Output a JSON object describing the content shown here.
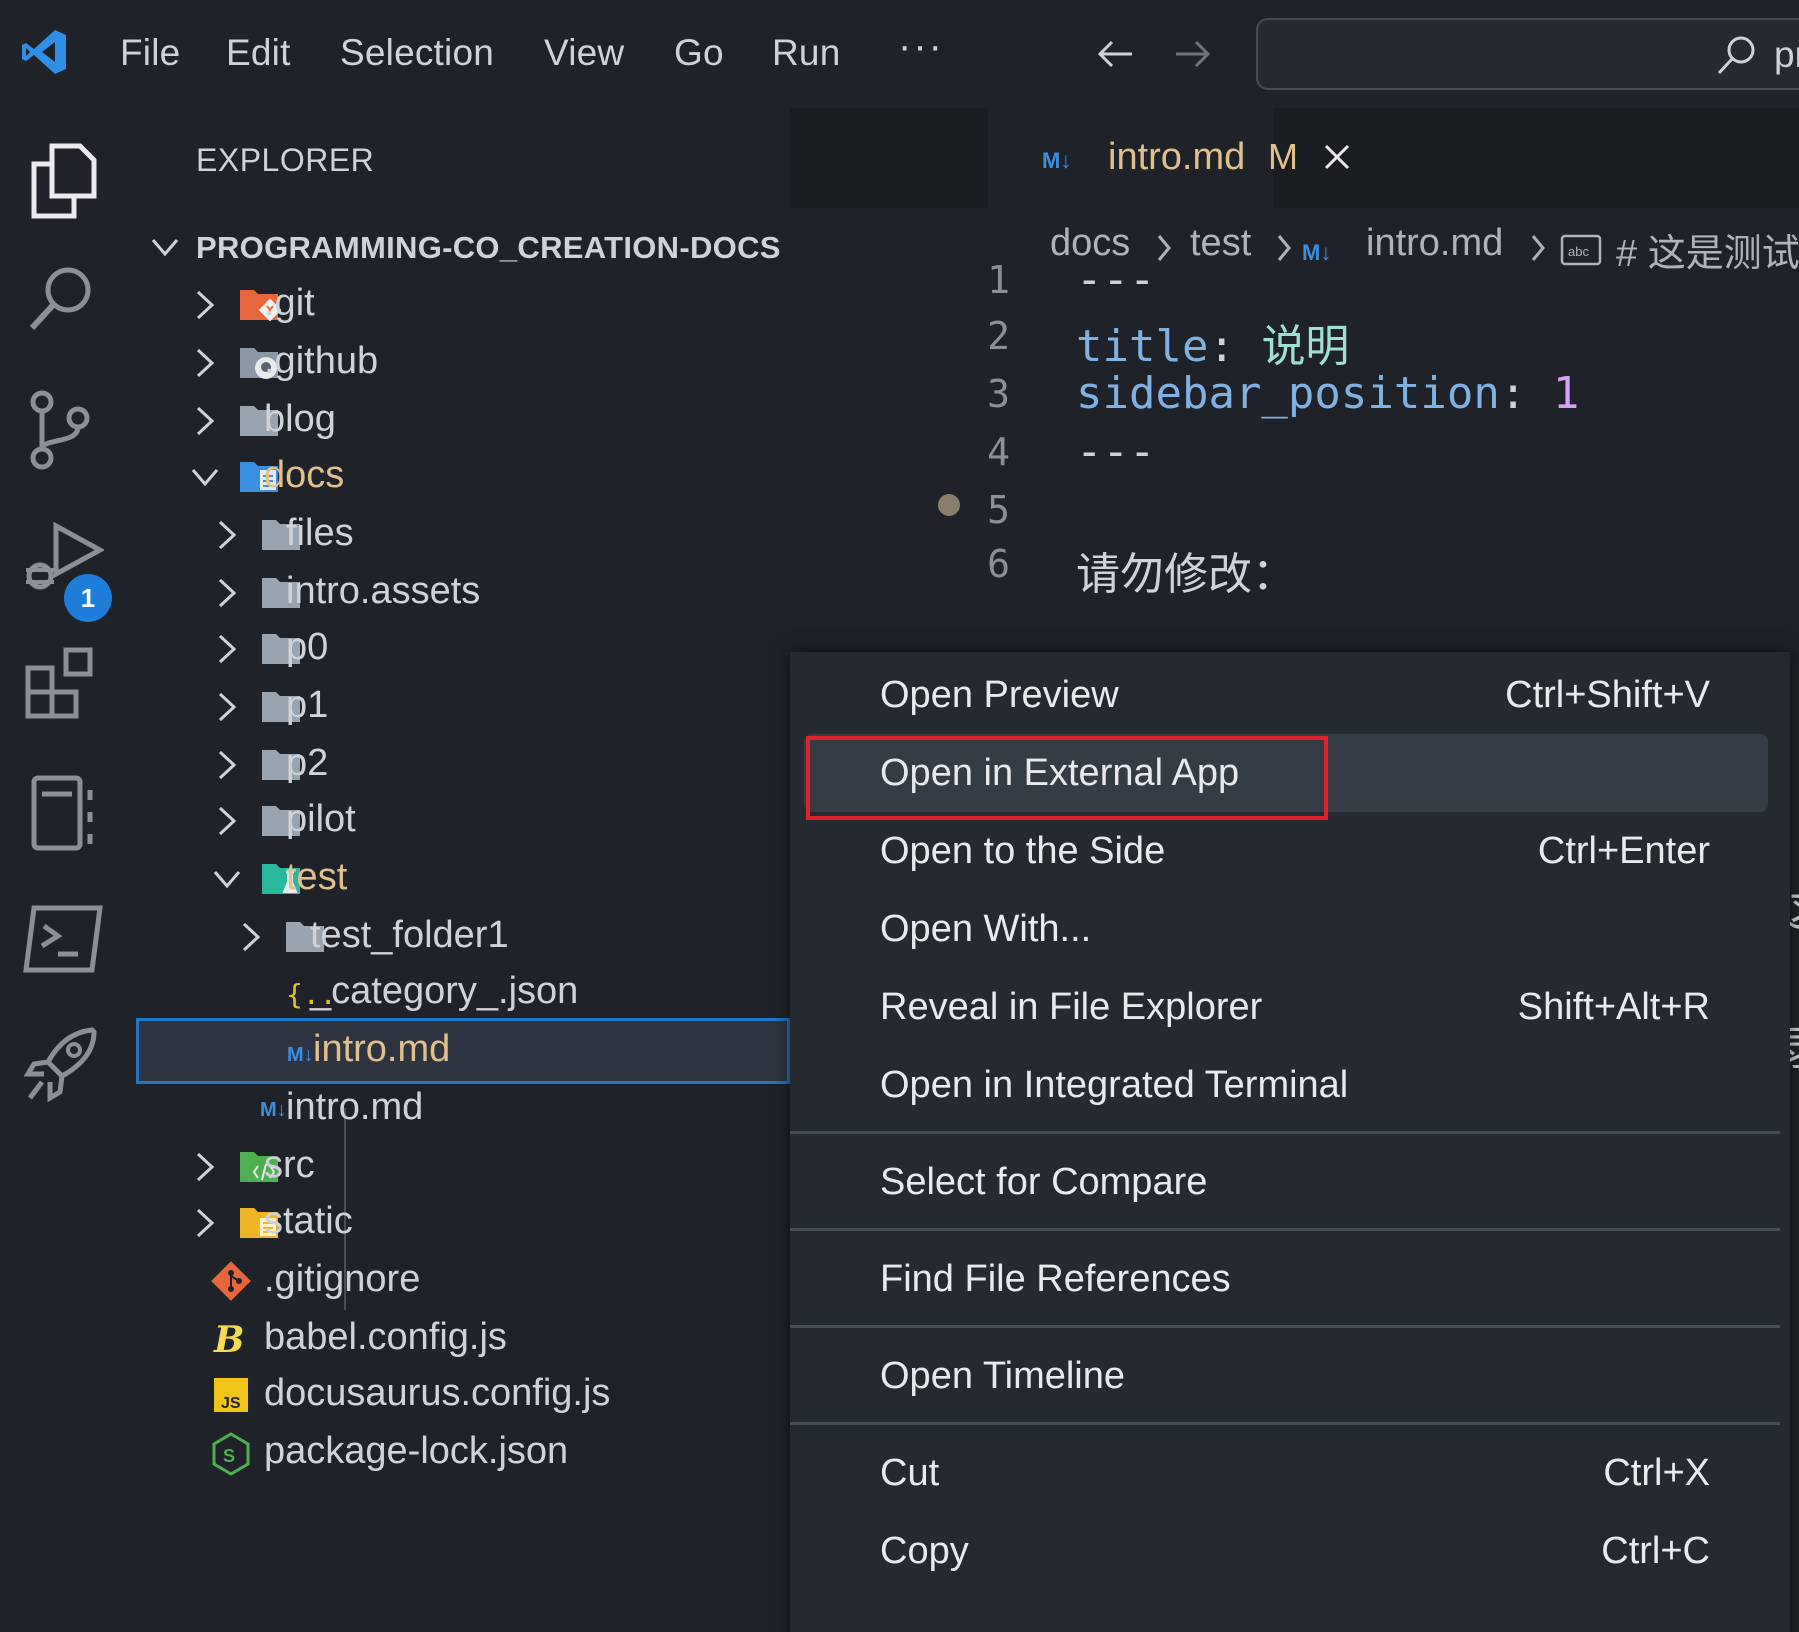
{
  "menubar": {
    "items": [
      "File",
      "Edit",
      "Selection",
      "View",
      "Go",
      "Run"
    ],
    "more": "···",
    "search_text": "pr"
  },
  "activity_bar": {
    "source_control_badge": "1"
  },
  "explorer": {
    "title": "EXPLORER",
    "more": "···",
    "root": "PROGRAMMING-CO_CREATION-DOCS",
    "items": [
      {
        "label": ".git",
        "type": "folder",
        "icon": "git-folder-icon",
        "color": "#cfd3d9"
      },
      {
        "label": ".github",
        "type": "folder",
        "icon": "github-folder-icon",
        "color": "#cfd3d9"
      },
      {
        "label": "blog",
        "type": "folder",
        "icon": "folder-icon",
        "color": "#cfd3d9"
      },
      {
        "label": "docs",
        "type": "folder-open",
        "icon": "docs-folder-icon",
        "color": "#e2c08d"
      },
      {
        "label": "files",
        "type": "folder",
        "icon": "folder-icon",
        "color": "#cfd3d9"
      },
      {
        "label": "intro.assets",
        "type": "folder",
        "icon": "folder-icon",
        "color": "#cfd3d9"
      },
      {
        "label": "p0",
        "type": "folder",
        "icon": "folder-icon",
        "color": "#cfd3d9"
      },
      {
        "label": "p1",
        "type": "folder",
        "icon": "folder-icon",
        "color": "#cfd3d9"
      },
      {
        "label": "p2",
        "type": "folder",
        "icon": "folder-icon",
        "color": "#cfd3d9"
      },
      {
        "label": "pilot",
        "type": "folder",
        "icon": "folder-icon",
        "color": "#cfd3d9"
      },
      {
        "label": "test",
        "type": "folder-open",
        "icon": "test-folder-icon",
        "color": "#e2c08d"
      },
      {
        "label": "test_folder1",
        "type": "folder",
        "icon": "folder-icon",
        "color": "#cfd3d9"
      },
      {
        "label": "_category_.json",
        "type": "file",
        "icon": "json-file-icon",
        "color": "#cfd3d9"
      },
      {
        "label": "intro.md",
        "type": "file",
        "icon": "markdown-file-icon",
        "color": "#e2c08d"
      },
      {
        "label": "intro.md",
        "type": "file",
        "icon": "markdown-file-icon",
        "color": "#cfd3d9"
      },
      {
        "label": "src",
        "type": "folder",
        "icon": "src-folder-icon",
        "color": "#cfd3d9"
      },
      {
        "label": "static",
        "type": "folder",
        "icon": "static-folder-icon",
        "color": "#cfd3d9"
      },
      {
        "label": ".gitignore",
        "type": "file",
        "icon": "git-file-icon",
        "color": "#cfd3d9"
      },
      {
        "label": "babel.config.js",
        "type": "file",
        "icon": "babel-file-icon",
        "color": "#cfd3d9"
      },
      {
        "label": "docusaurus.config.js",
        "type": "file",
        "icon": "js-file-icon",
        "color": "#cfd3d9"
      },
      {
        "label": "package-lock.json",
        "type": "file",
        "icon": "node-file-icon",
        "color": "#cfd3d9"
      }
    ]
  },
  "editor": {
    "tab": {
      "label": "intro.md",
      "status": "M"
    },
    "breadcrumbs": [
      "docs",
      "test",
      "intro.md",
      "# 这是测试"
    ],
    "lines": [
      {
        "num": "1",
        "parts": [
          {
            "t": "---",
            "c": "#cfd3d9"
          }
        ]
      },
      {
        "num": "2",
        "parts": [
          {
            "t": "title",
            "c": "#7fb1e3"
          },
          {
            "t": ": ",
            "c": "#cfd3d9"
          },
          {
            "t": "说明",
            "c": "#9fe0d3"
          }
        ]
      },
      {
        "num": "3",
        "parts": [
          {
            "t": "sidebar_position",
            "c": "#7fb1e3"
          },
          {
            "t": ": ",
            "c": "#cfd3d9"
          },
          {
            "t": "1",
            "c": "#d6a0f5"
          }
        ]
      },
      {
        "num": "4",
        "parts": [
          {
            "t": "---",
            "c": "#cfd3d9"
          }
        ]
      },
      {
        "num": "5",
        "parts": []
      },
      {
        "num": "6",
        "parts": [
          {
            "t": "请勿修改：",
            "c": "#cfd3d9"
          }
        ]
      }
    ],
    "right_edge_glyphs": [
      "这",
      "录"
    ]
  },
  "context_menu": {
    "groups": [
      [
        {
          "label": "Open Preview",
          "key": "Ctrl+Shift+V"
        },
        {
          "label": "Open in External App",
          "key": "",
          "hover": true
        },
        {
          "label": "Open to the Side",
          "key": "Ctrl+Enter"
        },
        {
          "label": "Open With...",
          "key": ""
        },
        {
          "label": "Reveal in File Explorer",
          "key": "Shift+Alt+R"
        },
        {
          "label": "Open in Integrated Terminal",
          "key": ""
        }
      ],
      [
        {
          "label": "Select for Compare",
          "key": ""
        }
      ],
      [
        {
          "label": "Find File References",
          "key": ""
        }
      ],
      [
        {
          "label": "Open Timeline",
          "key": ""
        }
      ],
      [
        {
          "label": "Cut",
          "key": "Ctrl+X"
        },
        {
          "label": "Copy",
          "key": "Ctrl+C"
        }
      ]
    ]
  },
  "colors": {
    "accent": "#2176c7",
    "highlight_box": "#e0232b",
    "modified": "#e2c08d"
  }
}
